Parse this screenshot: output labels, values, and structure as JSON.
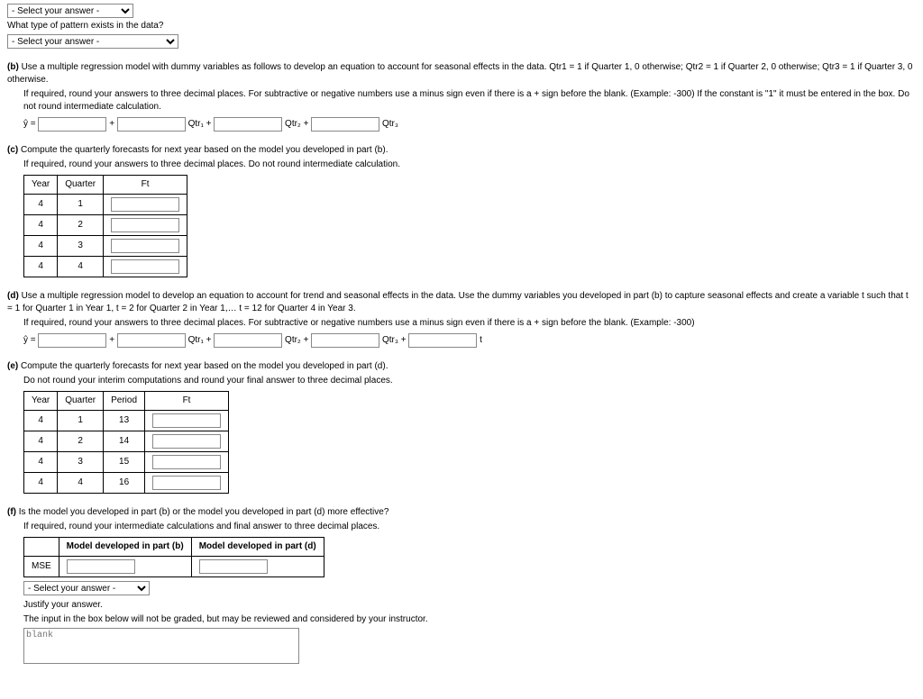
{
  "top": {
    "select_placeholder": "- Select your answer -",
    "question": "What type of pattern exists in the data?"
  },
  "b": {
    "label": "(b)",
    "line1": "Use a multiple regression model with dummy variables as follows to develop an equation to account for seasonal effects in the data. Qtr1 = 1 if Quarter 1, 0 otherwise; Qtr2 = 1 if Quarter 2, 0 otherwise; Qtr3 = 1 if Quarter 3, 0 otherwise.",
    "line2": "If required, round your answers to three decimal places. For subtractive or negative numbers use a minus sign even if there is a + sign before the blank. (Example: -300) If the constant is \"1\" it must be entered in the box. Do not round intermediate calculation.",
    "yhat": "ŷ =",
    "plus": "+",
    "q1": "Qtr₁ +",
    "q2": "Qtr₂ +",
    "q3": "Qtr₃"
  },
  "c": {
    "label": "(c)",
    "line1": "Compute the quarterly forecasts for next year based on the model you developed in part (b).",
    "line2": "If required, round your answers to three decimal places. Do not round intermediate calculation.",
    "headers": [
      "Year",
      "Quarter",
      "Ft"
    ],
    "rows": [
      {
        "year": "4",
        "quarter": "1"
      },
      {
        "year": "4",
        "quarter": "2"
      },
      {
        "year": "4",
        "quarter": "3"
      },
      {
        "year": "4",
        "quarter": "4"
      }
    ]
  },
  "d": {
    "label": "(d)",
    "line1": "Use a multiple regression model to develop an equation to account for trend and seasonal effects in the data. Use the dummy variables you developed in part (b) to capture seasonal effects and create a variable t such that t = 1 for Quarter 1 in Year 1, t = 2 for Quarter 2 in Year 1,… t = 12 for Quarter 4 in Year 3.",
    "line2": "If required, round your answers to three decimal places. For subtractive or negative numbers use a minus sign even if there is a + sign before the blank. (Example: -300)",
    "yhat": "ŷ =",
    "plus": "+",
    "q1": "Qtr₁ +",
    "q2": "Qtr₂ +",
    "q3": "Qtr₃ +",
    "t": "t"
  },
  "e": {
    "label": "(e)",
    "line1": "Compute the quarterly forecasts for next year based on the model you developed in part (d).",
    "line2": "Do not round your interim computations and round your final answer to three decimal places.",
    "headers": [
      "Year",
      "Quarter",
      "Period",
      "Ft"
    ],
    "rows": [
      {
        "year": "4",
        "quarter": "1",
        "period": "13"
      },
      {
        "year": "4",
        "quarter": "2",
        "period": "14"
      },
      {
        "year": "4",
        "quarter": "3",
        "period": "15"
      },
      {
        "year": "4",
        "quarter": "4",
        "period": "16"
      }
    ]
  },
  "f": {
    "label": "(f)",
    "line1": "Is the model you developed in part (b) or the model you developed in part (d) more effective?",
    "line2": "If required, round your intermediate calculations and final answer to three decimal places.",
    "col_b": "Model developed in part (b)",
    "col_d": "Model developed in part (d)",
    "mse": "MSE",
    "select_placeholder": "- Select your answer -",
    "justify": "Justify your answer.",
    "note": "The input in the box below will not be graded, but may be reviewed and considered by your instructor.",
    "blank": "blank"
  }
}
